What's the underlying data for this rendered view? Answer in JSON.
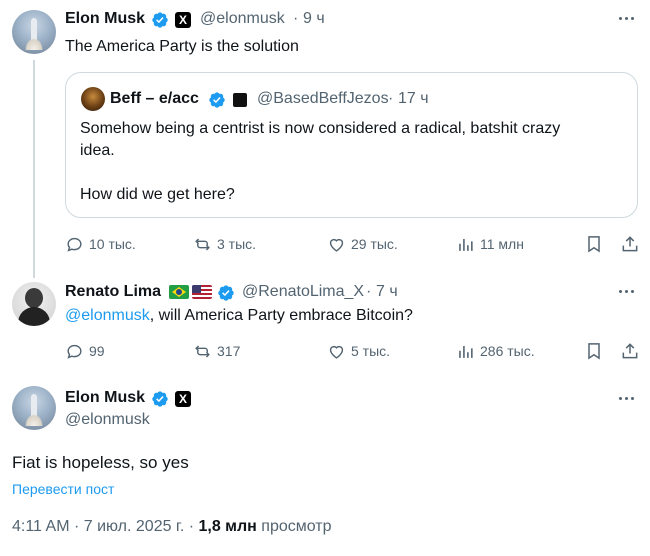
{
  "tweet1": {
    "name": "Elon Musk",
    "handle": "@elonmusk",
    "dot": "·",
    "time": "9 ч",
    "text": "The America Party is the solution",
    "quote": {
      "name": "Beff – e/acc",
      "handle": "@BasedBeffJezos",
      "dot": "·",
      "time": "17 ч",
      "line1": "Somehow being a centrist is now considered a radical, batshit crazy",
      "line2": "idea.",
      "line3": "How did we get here?"
    },
    "replies": "10 тыс.",
    "reposts": "3 тыс.",
    "likes": "29 тыс.",
    "views": "11 млн"
  },
  "tweet2": {
    "name": "Renato Lima",
    "flags": [
      "brazil-flag",
      "us-flag"
    ],
    "handle": "@RenatoLima_X",
    "dot": "·",
    "time": "7 ч",
    "mention": "@elonmusk",
    "text": ", will America Party embrace Bitcoin?",
    "replies": "99",
    "reposts": "317",
    "likes": "5 тыс.",
    "views": "286 тыс."
  },
  "main": {
    "name": "Elon Musk",
    "handle": "@elonmusk",
    "text": "Fiat is hopeless, so yes",
    "translate": "Перевести пост",
    "timestamp": "4:11 AM · 7 июл. 2025 г. ·",
    "views_count": "1,8 млн",
    "views_label": "просмотр"
  },
  "colors": {
    "accent": "#1d9bf0",
    "muted": "#536471",
    "text": "#0f1419",
    "border": "#cfd9de"
  }
}
